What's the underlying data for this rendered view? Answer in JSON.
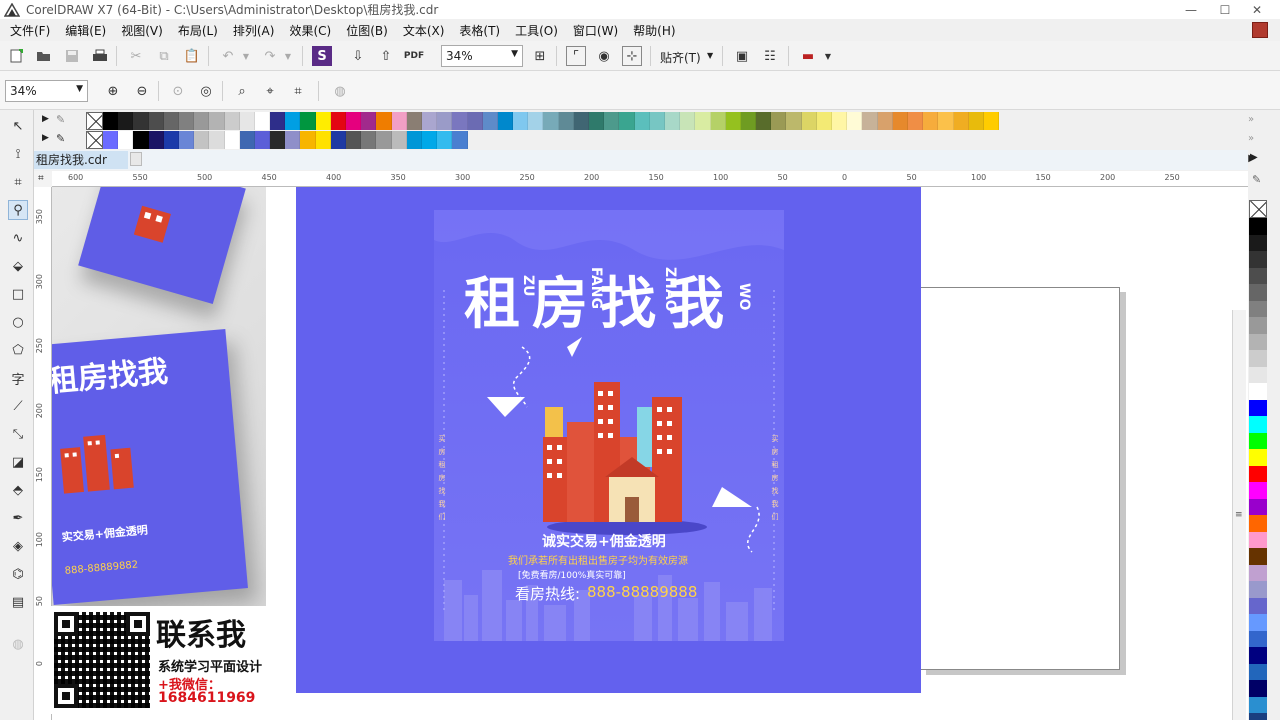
{
  "window": {
    "title": "CorelDRAW X7 (64-Bit) - C:\\Users\\Administrator\\Desktop\\租房找我.cdr",
    "minimize": "—",
    "maximize": "☐",
    "close": "✕"
  },
  "menu": [
    "文件(F)",
    "编辑(E)",
    "视图(V)",
    "布局(L)",
    "排列(A)",
    "效果(C)",
    "位图(B)",
    "文本(X)",
    "表格(T)",
    "工具(O)",
    "窗口(W)",
    "帮助(H)"
  ],
  "toolbar": {
    "zoom_value": "34%",
    "snap_label": "贴齐(T)"
  },
  "zoombar": {
    "zoom_value": "34%"
  },
  "document": {
    "tab_name": "租房找我.cdr"
  },
  "ruler": {
    "h_ticks": [
      "600",
      "550",
      "500",
      "450",
      "400",
      "350",
      "300",
      "250",
      "200",
      "150",
      "100",
      "50",
      "0",
      "50",
      "100",
      "150",
      "200",
      "250"
    ],
    "v_ticks": [
      "350",
      "300",
      "250",
      "200",
      "150",
      "100",
      "50",
      "0"
    ]
  },
  "poster": {
    "title": "租房找我",
    "pinyin": [
      "ZU",
      "FANG",
      "ZHAO",
      "WO"
    ],
    "slogan": "诚实交易+佣金透明",
    "slogan_sub": "我们承若所有出租出售房子均为有效房源",
    "slogan_note": "[免费看房/100%真实可靠]",
    "hotline_label": "看房热线:",
    "hotline_number": "888-88889888",
    "side_text": "买房租房找我们",
    "preview_title": "租房找我",
    "preview_slogan": "实交易+佣金透明",
    "preview_number": "888-88889882"
  },
  "contact": {
    "title": "联系我",
    "subtitle": "系统学习平面设计",
    "wechat_label": "+我微信：",
    "wechat_number": "1684611969"
  },
  "colors": {
    "poster_bg": "#6361ee",
    "accent_yellow": "#ffd24a",
    "accent_red": "#d9141b"
  },
  "palette_row1": [
    "#000000",
    "#1a1a1a",
    "#333333",
    "#4d4d4d",
    "#666666",
    "#808080",
    "#999999",
    "#b3b3b3",
    "#cccccc",
    "#e6e6e6",
    "#ffffff",
    "#2e2e8a",
    "#009fe3",
    "#00963f",
    "#ffed00",
    "#e30613",
    "#e5007e",
    "#a12a8c",
    "#ef7d00",
    "#f29fc5",
    "#8a7e73",
    "#aaa6cf",
    "#9a9bc8",
    "#7a77bf",
    "#6b6bb3",
    "#5e8bc9",
    "#0088cc",
    "#7fc8ef",
    "#a3d2e8",
    "#77aab8",
    "#5f8a96",
    "#406673",
    "#2f7a6b",
    "#4d9a8c",
    "#3aa590",
    "#5bbfbc",
    "#77c6c3",
    "#a8d8c8",
    "#c8e4b7",
    "#d9eca2",
    "#b5d167",
    "#95c11f",
    "#6f9c22",
    "#586c2b",
    "#9a9a55",
    "#bcb86b",
    "#dcd565",
    "#f3ea74",
    "#fff6a5",
    "#fffbd6",
    "#c7b299",
    "#d8a16b",
    "#e6892c",
    "#f08e45",
    "#f6ac3c",
    "#fbc14a",
    "#f0ad22",
    "#e8bb0c",
    "#ffcc00"
  ],
  "palette_row2": [
    "#6b6bff",
    "#ffffff",
    "#000000",
    "#1b1464",
    "#1c3aa9",
    "#6a85d6",
    "#c3c3c3",
    "#dcdcdc",
    "#ffffff",
    "#3f67b1",
    "#5b5fd8",
    "#2a2a2a",
    "#8f8fc9",
    "#f7b500",
    "#ffe100",
    "#1f3aa3",
    "#555555",
    "#777777",
    "#999999",
    "#bbbbbb",
    "#0097d7",
    "#00a8e8",
    "#33bbee",
    "#4a7fd0"
  ],
  "right_palette": [
    "#000000",
    "#1a1a1a",
    "#333333",
    "#4d4d4d",
    "#666666",
    "#808080",
    "#999999",
    "#b3b3b3",
    "#cccccc",
    "#e6e6e6",
    "#ffffff",
    "#0000ff",
    "#00ffff",
    "#00ff00",
    "#ffff00",
    "#ff0000",
    "#ff00ff",
    "#9900cc",
    "#ff6600",
    "#ff99cc",
    "#663300",
    "#c0a0d0",
    "#9999cc",
    "#6666cc",
    "#6699ff",
    "#3366cc",
    "#000080",
    "#2266bb",
    "#000066",
    "#2a8fd0",
    "#1a3f80"
  ]
}
